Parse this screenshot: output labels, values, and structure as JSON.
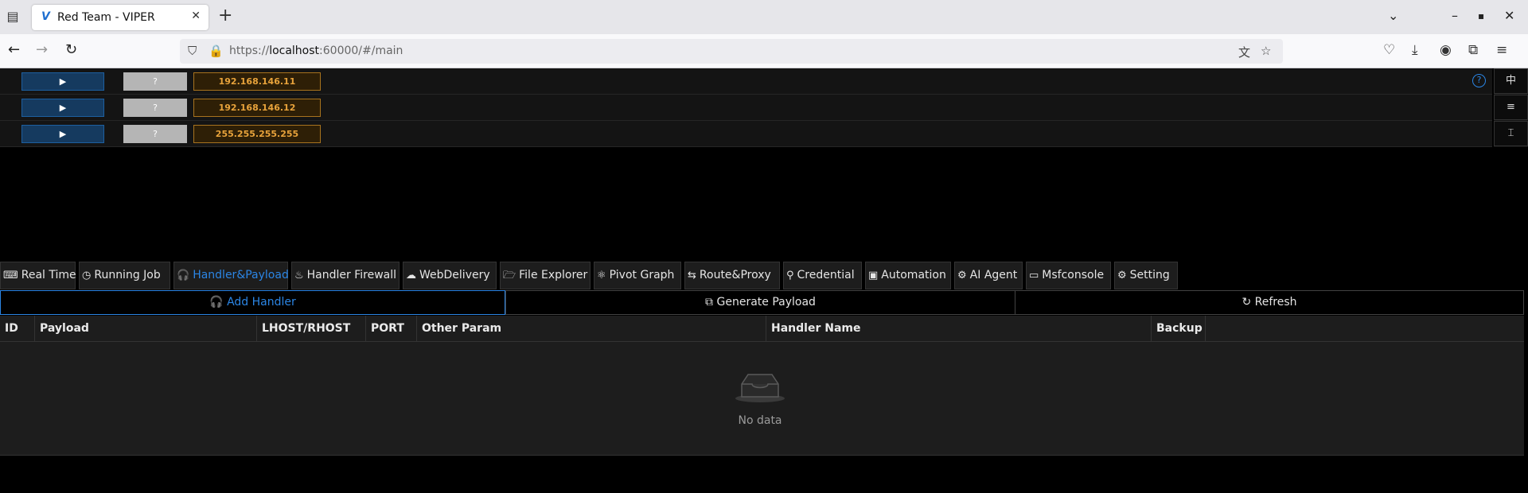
{
  "browser": {
    "tab_title": "Red Team - VIPER",
    "tab_favicon": "V",
    "url_prefix": "https://",
    "url_host": "localhost",
    "url_rest": ":60000/#/main"
  },
  "hosts": [
    {
      "button": "▶",
      "status": "?",
      "ip": "192.168.146.11"
    },
    {
      "button": "▶",
      "status": "?",
      "ip": "192.168.146.12"
    },
    {
      "button": "▶",
      "status": "?",
      "ip": "255.255.255.255"
    }
  ],
  "help_icon": "?",
  "side_tools": [
    "中",
    "≡",
    "⌶"
  ],
  "tabs": [
    {
      "icon": "⌨",
      "label": "Real Time"
    },
    {
      "icon": "◷",
      "label": "Running Job"
    },
    {
      "icon": "🎧",
      "label": "Handler&Payload"
    },
    {
      "icon": "♨",
      "label": "Handler Firewall"
    },
    {
      "icon": "☁",
      "label": "WebDelivery"
    },
    {
      "icon": "🗁",
      "label": "File Explorer"
    },
    {
      "icon": "⚛",
      "label": "Pivot Graph"
    },
    {
      "icon": "⇆",
      "label": "Route&Proxy"
    },
    {
      "icon": "⚲",
      "label": "Credential"
    },
    {
      "icon": "▣",
      "label": "Automation"
    },
    {
      "icon": "⚙",
      "label": "AI Agent"
    },
    {
      "icon": "▭",
      "label": "Msfconsole"
    },
    {
      "icon": "⚙",
      "label": "Setting"
    }
  ],
  "active_tab": "Handler&Payload",
  "actions": {
    "add_handler": "Add Handler",
    "generate_payload": "Generate Payload",
    "refresh": "Refresh"
  },
  "table": {
    "columns": [
      "ID",
      "Payload",
      "LHOST/RHOST",
      "PORT",
      "Other Param",
      "Handler Name",
      "Backup"
    ],
    "empty_text": "No data"
  },
  "colors": {
    "accent": "#2b85e4",
    "ip_text": "#e8a33b",
    "host_button": "#153a5f"
  }
}
